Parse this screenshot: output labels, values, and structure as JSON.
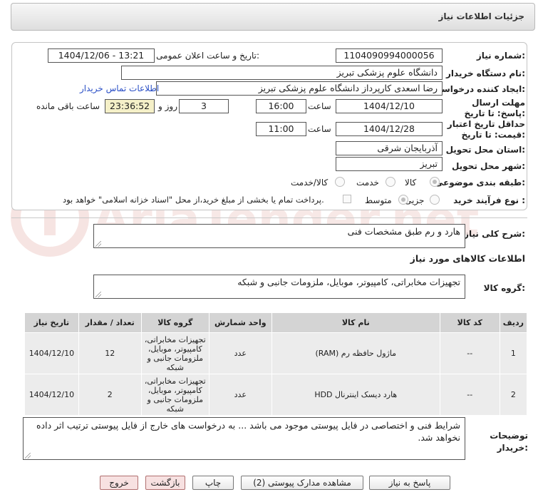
{
  "window": {
    "title": "جزئیات اطلاعات نیاز"
  },
  "form": {
    "need_number_label": "شماره نیاز:",
    "need_number": "1104090994000056",
    "announce_label": "تاریخ و ساعت اعلان عمومی:",
    "announce_value": "1404/12/06 - 13:21",
    "buyer_org_label": "نام دستگاه خریدار:",
    "buyer_org": "دانشگاه علوم پزشکی تبریز",
    "creator_label": "ایجاد کننده درخواست:",
    "creator": "رضا اسعدی کارپرداز دانشگاه علوم پزشکی تبریز",
    "contact_link": "اطلاعات تماس خریدار",
    "deadline_label": "مهلت ارسال پاسخ: تا تاریخ:",
    "deadline_date": "1404/12/10",
    "time_label": "ساعت",
    "deadline_time": "16:00",
    "days_value": "3",
    "days_label": "روز و",
    "remaining_time": "23:36:52",
    "remaining_label": "ساعت باقی مانده",
    "validity_label": "حداقل تاریخ اعتبار قیمت: تا تاریخ:",
    "validity_date": "1404/12/28",
    "validity_time": "11:00",
    "province_label": "استان محل تحویل:",
    "province": "آذربایجان شرقی",
    "city_label": "شهر محل تحویل:",
    "city": "تبریز",
    "category_label": "طبقه بندی موضوعی:",
    "category_options": [
      "کالا",
      "خدمت",
      "کالا/خدمت"
    ],
    "purchase_type_label": "نوع فرآیند خرید :",
    "purchase_options": [
      "جزیی",
      "متوسط"
    ],
    "payment_note": "پرداخت تمام یا بخشی از مبلغ خرید،از محل \"اسناد خزانه اسلامی\" خواهد بود."
  },
  "summary": {
    "label": "شرح کلی نیاز:",
    "value": "هارد و رم طبق مشخصات فنی"
  },
  "goods_info_title": "اطلاعات کالاهای مورد نیاز",
  "goods_group": {
    "label": "گروه کالا:",
    "value": "تجهیزات مخابراتی، کامپیوتر، موبایل، ملزومات جانبی و شبکه"
  },
  "table": {
    "headers": [
      "ردیف",
      "کد کالا",
      "نام کالا",
      "واحد شمارش",
      "گروه کالا",
      "تعداد / مقدار",
      "تاریخ نیاز"
    ],
    "rows": [
      [
        "1",
        "--",
        "ماژول حافظه رم (RAM)",
        "عدد",
        "تجهیزات مخابراتی، کامپیوتر، موبایل، ملزومات جانبی و شبکه",
        "12",
        "1404/12/10"
      ],
      [
        "2",
        "--",
        "هارد دیسک اینترنال HDD",
        "عدد",
        "تجهیزات مخابراتی، کامپیوتر، موبایل، ملزومات جانبی و شبکه",
        "2",
        "1404/12/10"
      ]
    ]
  },
  "buyer_notes": {
    "label": "توضیحات خریدار:",
    "value": "شرایط فنی و اختصاصی در فایل پیوستی موجود می باشد ... به درخواست های خارج از فایل پیوستی ترتیب اثر داده نخواهد شد."
  },
  "buttons": {
    "reply": "پاسخ به نیاز",
    "attachments": "مشاهده مدارک پیوستی (2)",
    "print": "چاپ",
    "back": "بازگشت",
    "exit": "خروج"
  },
  "watermark": {
    "text": "AriaTender.net"
  },
  "colors": {
    "link": "#2a4fc6",
    "remaining_bg": "#f5f0c8",
    "header_bg": "#d4d4d4",
    "row_bg": "#ececec"
  }
}
